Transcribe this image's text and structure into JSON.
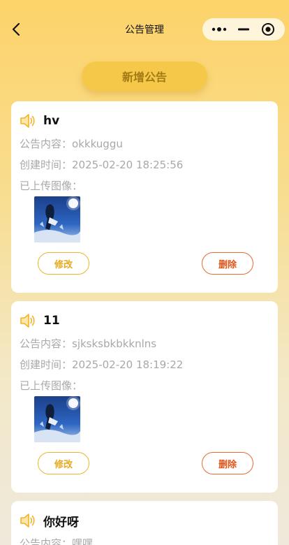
{
  "nav": {
    "title": "公告管理"
  },
  "add_button_label": "新增公告",
  "labels": {
    "content": "公告内容：",
    "time": "创建时间：",
    "images": "已上传图像：",
    "edit": "修改",
    "delete": "删除"
  },
  "announcements": [
    {
      "title": "hv",
      "content": "okkkuggu",
      "time": "2025-02-20 18:25:56"
    },
    {
      "title": "11",
      "content": "sjksksbkbkknlns",
      "time": "2025-02-20 18:19:22"
    },
    {
      "title": "你好呀",
      "content": "嘿嘿",
      "time": ""
    }
  ],
  "colors": {
    "accent": "#f5c84a",
    "edit": "#e8a920",
    "delete": "#e2541a"
  },
  "icons": {
    "back": "chevron-left-icon",
    "more": "more-dots-icon",
    "minimize": "minimize-icon",
    "close": "target-circle-icon",
    "speaker": "speaker-icon"
  }
}
